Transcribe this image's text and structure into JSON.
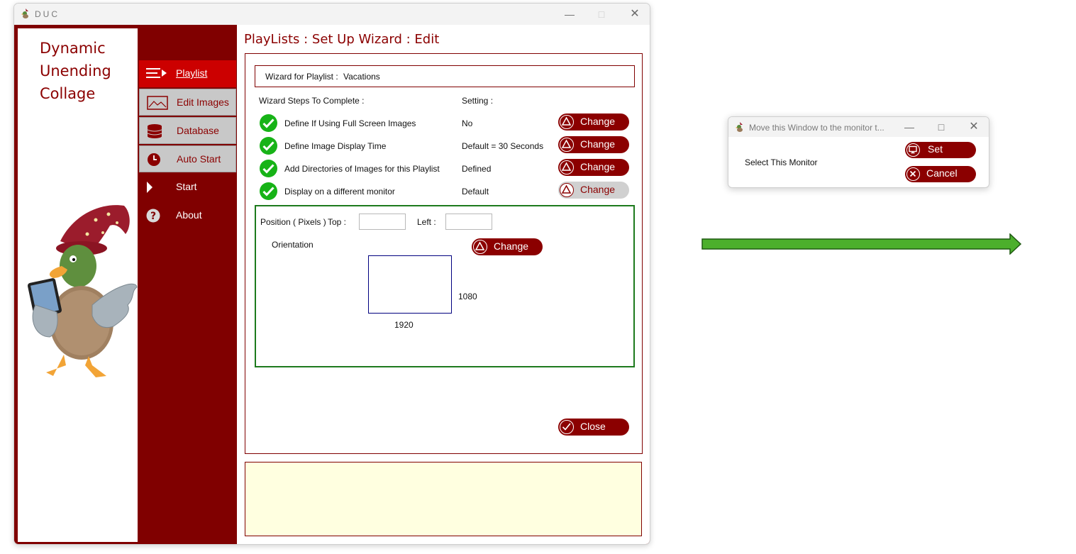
{
  "window": {
    "title": "DUC"
  },
  "logo": {
    "line1": "Dynamic",
    "line2": "Unending",
    "line3": "Collage"
  },
  "nav": [
    {
      "label": "Playlist",
      "icon": "playlist-icon",
      "state": "active"
    },
    {
      "label": "Edit Images",
      "icon": "image-icon",
      "state": "normal"
    },
    {
      "label": "Database",
      "icon": "database-icon",
      "state": "normal"
    },
    {
      "label": "Auto Start",
      "icon": "clock-icon",
      "state": "normal"
    },
    {
      "label": "Start",
      "icon": "play-icon",
      "state": "dark"
    },
    {
      "label": "About",
      "icon": "help-icon",
      "state": "dark"
    }
  ],
  "page_title": "PlayLists : Set Up Wizard : Edit",
  "wizard": {
    "header_label": "Wizard for Playlist :",
    "playlist_name": "Vacations",
    "steps_heading": "Wizard Steps To Complete :",
    "setting_heading": "Setting :",
    "steps": [
      {
        "label": "Define If Using Full Screen Images",
        "setting": "No",
        "button": "Change"
      },
      {
        "label": "Define Image Display Time",
        "setting": "Default = 30 Seconds",
        "button": "Change"
      },
      {
        "label": "Add Directories of Images for this Playlist",
        "setting": "Defined",
        "button": "Change"
      },
      {
        "label": "Display on a different monitor",
        "setting": "Default",
        "button": "Change"
      }
    ]
  },
  "position": {
    "label": "Position ( Pixels )",
    "top_label": "Top :",
    "top_value": "",
    "left_label": "Left :",
    "left_value": "",
    "orientation_label": "Orientation",
    "orientation_button": "Change",
    "height": "1080",
    "width": "1920"
  },
  "close_button": "Close",
  "status_text": "",
  "dialog": {
    "title": "Move this Window to the monitor t...",
    "label": "Select This Monitor",
    "set_button": "Set",
    "cancel_button": "Cancel"
  },
  "colors": {
    "brand": "#800000",
    "nav_active": "#cc0000",
    "check": "#17b317",
    "position_border": "#1d7a1d",
    "arrow": "#4caf2c"
  }
}
